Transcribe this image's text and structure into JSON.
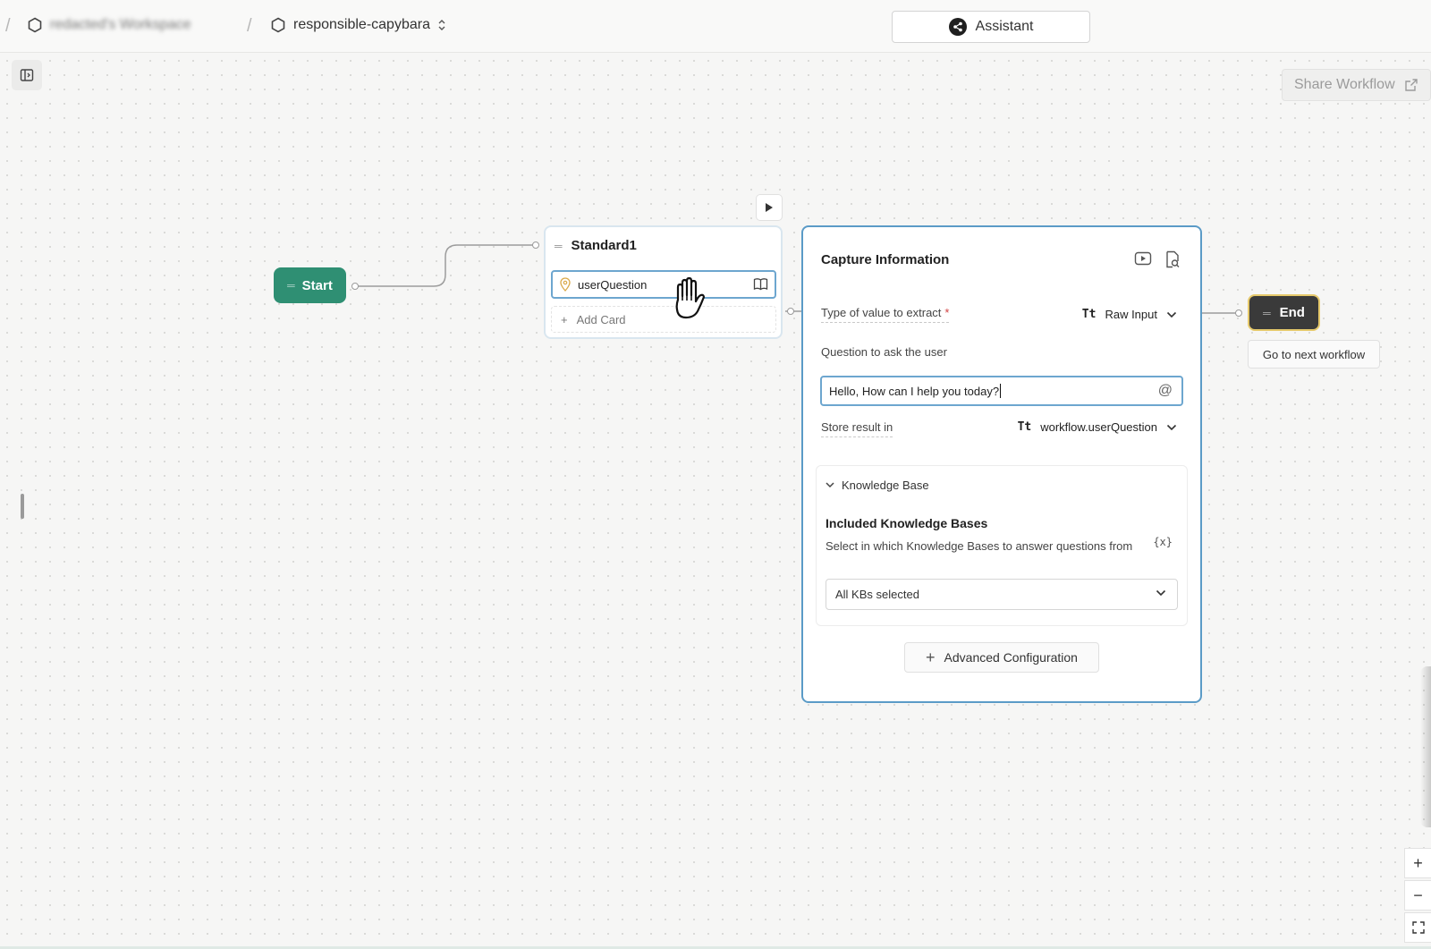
{
  "breadcrumb": {
    "workspace": "redacted's Workspace",
    "project": "responsible-capybara"
  },
  "header": {
    "assistant_label": "Assistant"
  },
  "toolbar": {
    "share_label": "Share Workflow"
  },
  "start_node": {
    "label": "Start"
  },
  "standard_block": {
    "title": "Standard1",
    "card_label": "userQuestion",
    "add_card_label": "Add Card"
  },
  "capture_panel": {
    "title": "Capture Information",
    "type_label": "Type of value to extract",
    "required_mark": "*",
    "type_icon": "Tt",
    "type_value": "Raw Input",
    "question_label": "Question to ask the user",
    "question_value": "Hello, How can I help you today?",
    "store_label": "Store result in",
    "store_icon": "Tt",
    "store_value": "workflow.userQuestion",
    "kb_section_label": "Knowledge Base",
    "kb_title": "Included Knowledge Bases",
    "kb_description": "Select in which Knowledge Bases to answer questions from",
    "kb_variable_icon": "{x}",
    "kb_select_value": "All KBs selected",
    "advanced_label": "Advanced Configuration"
  },
  "end_node": {
    "label": "End",
    "next_workflow_label": "Go to next workflow"
  },
  "zoom": {
    "in": "+",
    "out": "−"
  },
  "colors": {
    "start": "#2f8f73",
    "end": "#3a3a3a",
    "selection": "#5b9bc7"
  }
}
